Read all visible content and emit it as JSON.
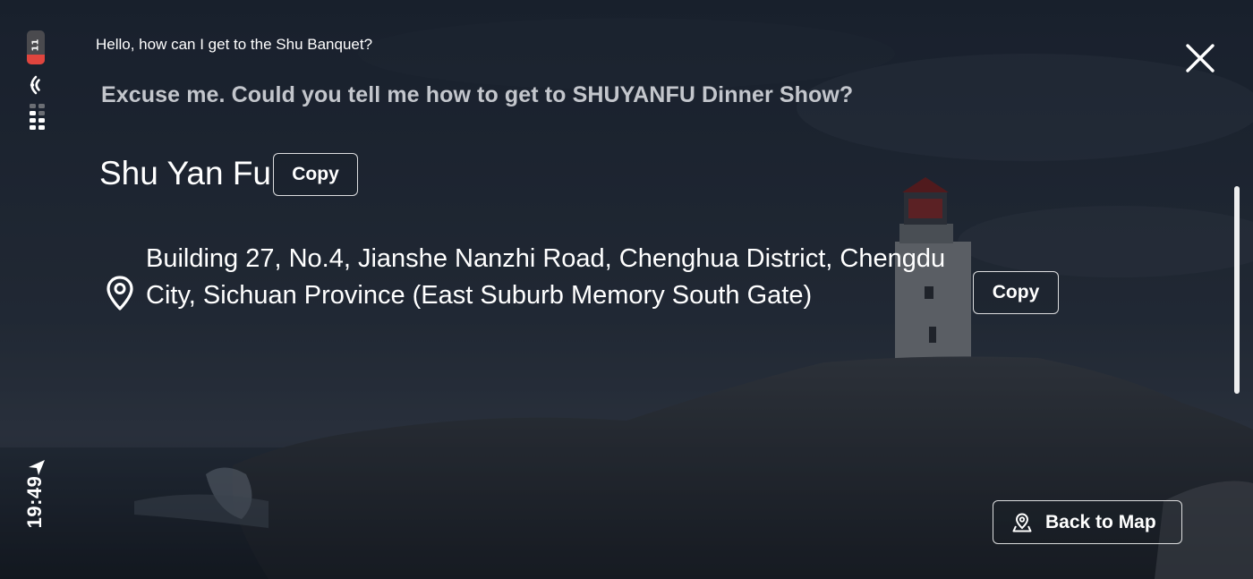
{
  "status_bar": {
    "battery_level": "11",
    "time": "19:49"
  },
  "conversation": {
    "source_text": "Hello, how can I get to the Shu Banquet?",
    "translation_text": "Excuse me. Could you tell me how to get to SHUYANFU Dinner Show?"
  },
  "place": {
    "name": "Shu Yan Fu",
    "address": "Building 27, No.4, Jianshe Nanzhi Road, Chenghua District, Chengdu City, Sichuan Province (East Suburb Memory South Gate)"
  },
  "buttons": {
    "copy_name_label": "Copy",
    "copy_address_label": "Copy",
    "back_to_map_label": "Back to Map"
  },
  "colors": {
    "battery_low": "#e0453e",
    "translation_text": "#c3c6cc",
    "text": "#ffffff"
  },
  "icons": [
    "battery-icon",
    "wifi-icon",
    "signal-icon",
    "location-arrow-icon",
    "close-icon",
    "location-pin-icon",
    "map-pin-icon"
  ]
}
